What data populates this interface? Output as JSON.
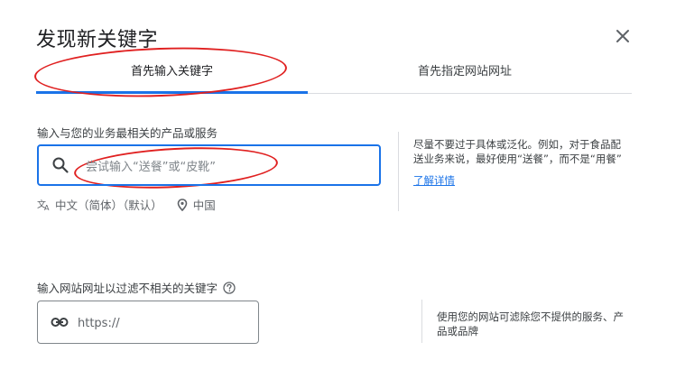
{
  "dialog": {
    "title": "发现新关键字",
    "close_icon": "close-icon"
  },
  "tabs": [
    {
      "label": "首先输入关键字",
      "active": true
    },
    {
      "label": "首先指定网站网址",
      "active": false
    }
  ],
  "keyword_section": {
    "label": "输入与您的业务最相关的产品或服务",
    "placeholder": "尝试输入“送餐”或“皮靴”",
    "language": "中文（简体）（默认）",
    "location": "中国",
    "hint_text": "尽量不要过于具体或泛化。例如，对于食品配送业务来说，最好使用“送餐”，而不是“用餐”",
    "hint_link": "了解详情"
  },
  "website_section": {
    "label": "输入网站网址以过滤不相关的关键字",
    "placeholder": "https://",
    "hint_text": "使用您的网站可滤除您不提供的服务、产品或品牌"
  },
  "colors": {
    "accent": "#1a73e8",
    "annotation": "#e02020"
  }
}
